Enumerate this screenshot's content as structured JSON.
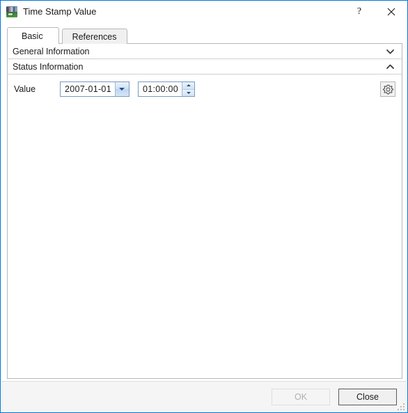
{
  "window": {
    "title": "Time Stamp Value",
    "icon": "time-stamp-value-icon",
    "accent_color": "#0078d7",
    "help_glyph": "?",
    "help_label": "Help",
    "close_label": "Close window"
  },
  "tabs": [
    {
      "label": "Basic",
      "active": true
    },
    {
      "label": "References",
      "active": false
    }
  ],
  "sections": [
    {
      "label": "General Information",
      "expanded": false,
      "chevron": "chevron-down-icon"
    },
    {
      "label": "Status Information",
      "expanded": true,
      "chevron": "chevron-up-icon"
    }
  ],
  "fields": {
    "value": {
      "label": "Value",
      "date": "2007-01-01",
      "time": "01:00:00",
      "date_dropdown_icon": "chevron-down-icon",
      "time_spinner_up_icon": "spinner-up-icon",
      "time_spinner_down_icon": "spinner-down-icon"
    }
  },
  "settings_button": {
    "icon": "gear-icon",
    "label": "Settings"
  },
  "footer": {
    "ok_label": "OK",
    "ok_enabled": false,
    "close_label": "Close",
    "close_default": true
  }
}
